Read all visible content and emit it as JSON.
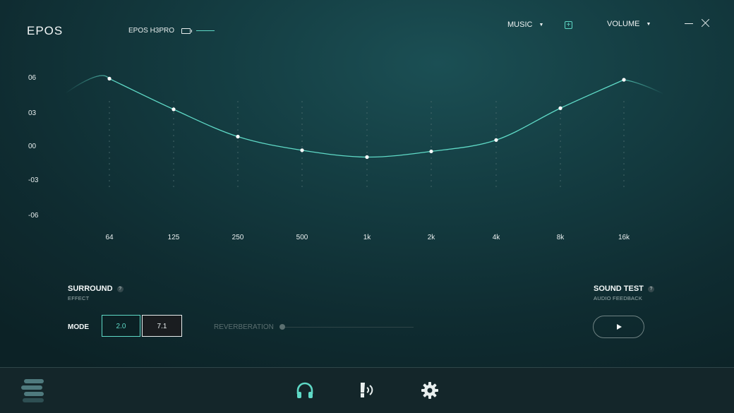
{
  "app": {
    "logo": "EPOS",
    "device_name": "EPOS H3PRO"
  },
  "header": {
    "profile_dropdown": "MUSIC",
    "volume_dropdown": "VOLUME"
  },
  "equalizer": {
    "db_labels": [
      "06",
      "03",
      "00",
      "-03",
      "-06"
    ],
    "frequencies": [
      "64",
      "125",
      "250",
      "500",
      "1k",
      "2k",
      "4k",
      "8k",
      "16k"
    ],
    "gains_db": [
      6.0,
      3.3,
      0.9,
      -0.3,
      -0.9,
      -0.4,
      0.6,
      3.4,
      5.9
    ],
    "accent_color": "#5fd9c6"
  },
  "surround": {
    "title": "SURROUND",
    "subtitle": "EFFECT",
    "mode_label": "MODE",
    "modes": [
      "2.0",
      "7.1"
    ],
    "selected_mode": "2.0",
    "reverb_label": "REVERBERATION",
    "reverb_level": 0
  },
  "sound_test": {
    "title": "SOUND TEST",
    "subtitle": "AUDIO FEEDBACK"
  },
  "bottom_nav": {
    "items": [
      "menu-icon",
      "headphones-icon",
      "microphone-icon",
      "gear-icon"
    ],
    "active": "headphones-icon"
  }
}
